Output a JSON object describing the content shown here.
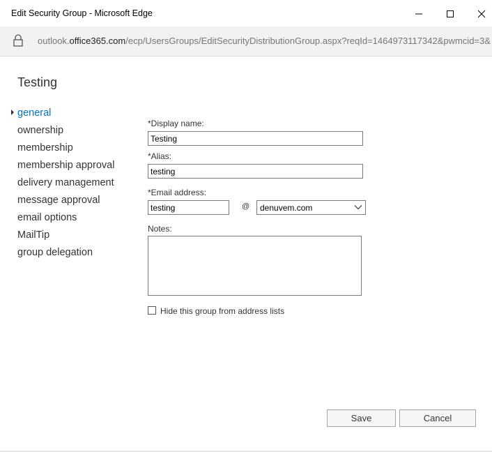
{
  "window": {
    "title": "Edit Security Group - Microsoft Edge",
    "controls": [
      "minimize-icon",
      "maximize-icon",
      "close-icon"
    ]
  },
  "address": {
    "url_prefix": "outlook.",
    "url_host": "office365.com",
    "url_path": "/ecp/UsersGroups/EditSecurityDistributionGroup.aspx?reqId=1464973117342&pwmcid=3&"
  },
  "page": {
    "title": "Testing"
  },
  "nav": {
    "items": [
      {
        "label": "general",
        "active": true
      },
      {
        "label": "ownership"
      },
      {
        "label": "membership"
      },
      {
        "label": "membership approval"
      },
      {
        "label": "delivery management"
      },
      {
        "label": "message approval"
      },
      {
        "label": "email options"
      },
      {
        "label": "MailTip"
      },
      {
        "label": "group delegation"
      }
    ]
  },
  "form": {
    "display_name_label": "*Display name:",
    "display_name_value": "Testing",
    "alias_label": "*Alias:",
    "alias_value": "testing",
    "email_label": "*Email address:",
    "email_value": "testing",
    "at_sign": "@",
    "domain_value": "denuvem.com",
    "notes_label": "Notes:",
    "notes_value": "",
    "hide_label": "Hide this group from address lists",
    "hide_checked": false
  },
  "buttons": {
    "save": "Save",
    "cancel": "Cancel"
  },
  "colors": {
    "accent": "#0072c6",
    "text": "#333333",
    "address_bar_bg": "#f2f2f2"
  }
}
